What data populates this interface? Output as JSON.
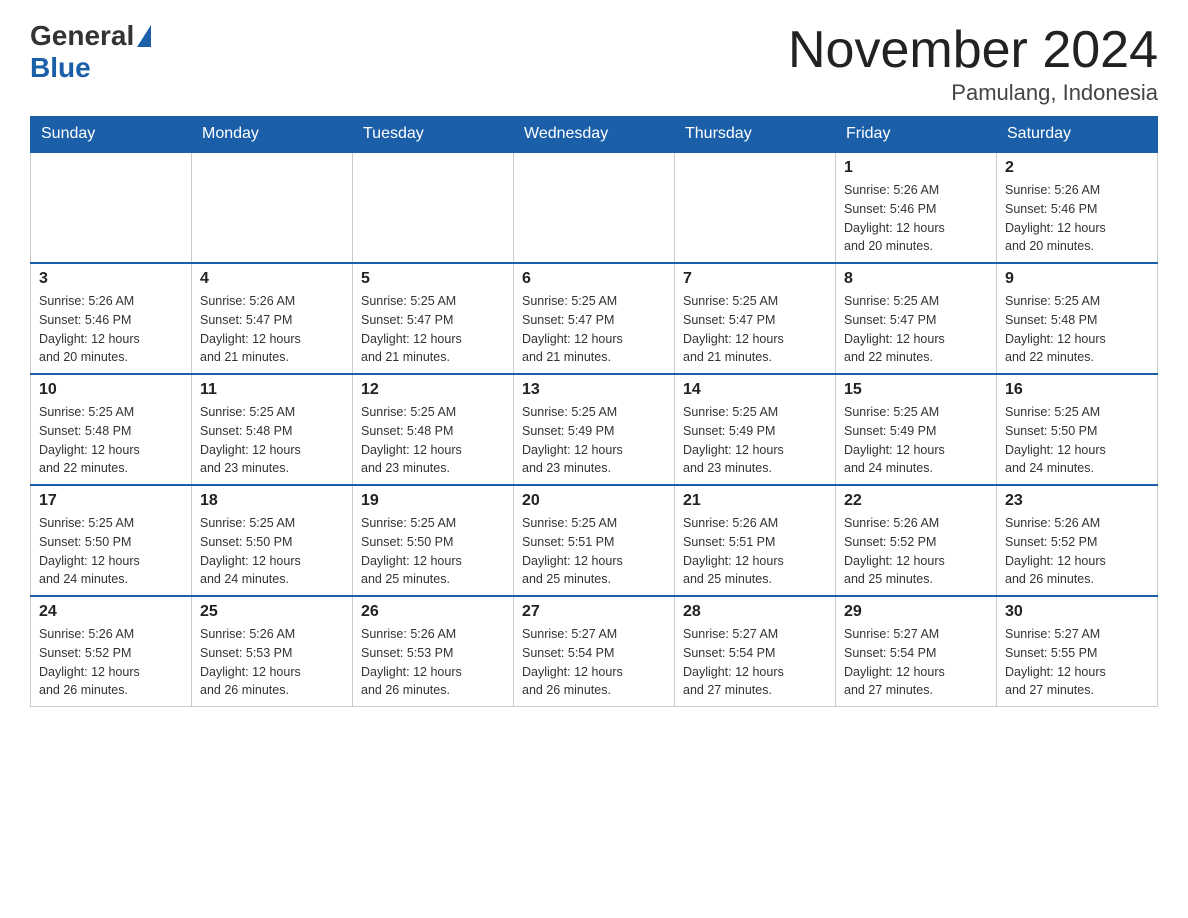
{
  "logo": {
    "general": "General",
    "blue": "Blue"
  },
  "title": "November 2024",
  "location": "Pamulang, Indonesia",
  "days_of_week": [
    "Sunday",
    "Monday",
    "Tuesday",
    "Wednesday",
    "Thursday",
    "Friday",
    "Saturday"
  ],
  "weeks": [
    [
      {
        "day": null,
        "info": null
      },
      {
        "day": null,
        "info": null
      },
      {
        "day": null,
        "info": null
      },
      {
        "day": null,
        "info": null
      },
      {
        "day": null,
        "info": null
      },
      {
        "day": "1",
        "info": "Sunrise: 5:26 AM\nSunset: 5:46 PM\nDaylight: 12 hours\nand 20 minutes."
      },
      {
        "day": "2",
        "info": "Sunrise: 5:26 AM\nSunset: 5:46 PM\nDaylight: 12 hours\nand 20 minutes."
      }
    ],
    [
      {
        "day": "3",
        "info": "Sunrise: 5:26 AM\nSunset: 5:46 PM\nDaylight: 12 hours\nand 20 minutes."
      },
      {
        "day": "4",
        "info": "Sunrise: 5:26 AM\nSunset: 5:47 PM\nDaylight: 12 hours\nand 21 minutes."
      },
      {
        "day": "5",
        "info": "Sunrise: 5:25 AM\nSunset: 5:47 PM\nDaylight: 12 hours\nand 21 minutes."
      },
      {
        "day": "6",
        "info": "Sunrise: 5:25 AM\nSunset: 5:47 PM\nDaylight: 12 hours\nand 21 minutes."
      },
      {
        "day": "7",
        "info": "Sunrise: 5:25 AM\nSunset: 5:47 PM\nDaylight: 12 hours\nand 21 minutes."
      },
      {
        "day": "8",
        "info": "Sunrise: 5:25 AM\nSunset: 5:47 PM\nDaylight: 12 hours\nand 22 minutes."
      },
      {
        "day": "9",
        "info": "Sunrise: 5:25 AM\nSunset: 5:48 PM\nDaylight: 12 hours\nand 22 minutes."
      }
    ],
    [
      {
        "day": "10",
        "info": "Sunrise: 5:25 AM\nSunset: 5:48 PM\nDaylight: 12 hours\nand 22 minutes."
      },
      {
        "day": "11",
        "info": "Sunrise: 5:25 AM\nSunset: 5:48 PM\nDaylight: 12 hours\nand 23 minutes."
      },
      {
        "day": "12",
        "info": "Sunrise: 5:25 AM\nSunset: 5:48 PM\nDaylight: 12 hours\nand 23 minutes."
      },
      {
        "day": "13",
        "info": "Sunrise: 5:25 AM\nSunset: 5:49 PM\nDaylight: 12 hours\nand 23 minutes."
      },
      {
        "day": "14",
        "info": "Sunrise: 5:25 AM\nSunset: 5:49 PM\nDaylight: 12 hours\nand 23 minutes."
      },
      {
        "day": "15",
        "info": "Sunrise: 5:25 AM\nSunset: 5:49 PM\nDaylight: 12 hours\nand 24 minutes."
      },
      {
        "day": "16",
        "info": "Sunrise: 5:25 AM\nSunset: 5:50 PM\nDaylight: 12 hours\nand 24 minutes."
      }
    ],
    [
      {
        "day": "17",
        "info": "Sunrise: 5:25 AM\nSunset: 5:50 PM\nDaylight: 12 hours\nand 24 minutes."
      },
      {
        "day": "18",
        "info": "Sunrise: 5:25 AM\nSunset: 5:50 PM\nDaylight: 12 hours\nand 24 minutes."
      },
      {
        "day": "19",
        "info": "Sunrise: 5:25 AM\nSunset: 5:50 PM\nDaylight: 12 hours\nand 25 minutes."
      },
      {
        "day": "20",
        "info": "Sunrise: 5:25 AM\nSunset: 5:51 PM\nDaylight: 12 hours\nand 25 minutes."
      },
      {
        "day": "21",
        "info": "Sunrise: 5:26 AM\nSunset: 5:51 PM\nDaylight: 12 hours\nand 25 minutes."
      },
      {
        "day": "22",
        "info": "Sunrise: 5:26 AM\nSunset: 5:52 PM\nDaylight: 12 hours\nand 25 minutes."
      },
      {
        "day": "23",
        "info": "Sunrise: 5:26 AM\nSunset: 5:52 PM\nDaylight: 12 hours\nand 26 minutes."
      }
    ],
    [
      {
        "day": "24",
        "info": "Sunrise: 5:26 AM\nSunset: 5:52 PM\nDaylight: 12 hours\nand 26 minutes."
      },
      {
        "day": "25",
        "info": "Sunrise: 5:26 AM\nSunset: 5:53 PM\nDaylight: 12 hours\nand 26 minutes."
      },
      {
        "day": "26",
        "info": "Sunrise: 5:26 AM\nSunset: 5:53 PM\nDaylight: 12 hours\nand 26 minutes."
      },
      {
        "day": "27",
        "info": "Sunrise: 5:27 AM\nSunset: 5:54 PM\nDaylight: 12 hours\nand 26 minutes."
      },
      {
        "day": "28",
        "info": "Sunrise: 5:27 AM\nSunset: 5:54 PM\nDaylight: 12 hours\nand 27 minutes."
      },
      {
        "day": "29",
        "info": "Sunrise: 5:27 AM\nSunset: 5:54 PM\nDaylight: 12 hours\nand 27 minutes."
      },
      {
        "day": "30",
        "info": "Sunrise: 5:27 AM\nSunset: 5:55 PM\nDaylight: 12 hours\nand 27 minutes."
      }
    ]
  ]
}
